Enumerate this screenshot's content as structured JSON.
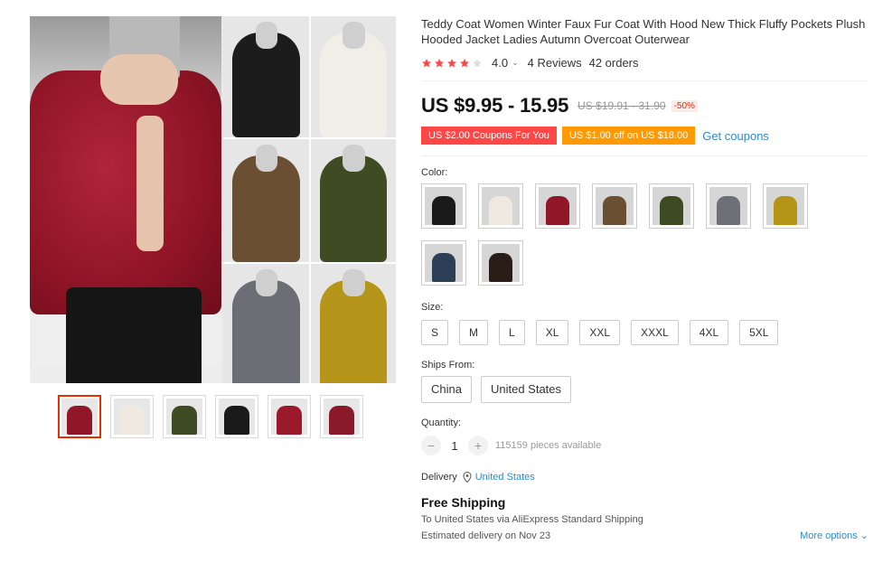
{
  "product": {
    "title": "Teddy Coat Women Winter Faux Fur Coat With Hood New Thick Fluffy Pockets Plush Hooded Jacket Ladies Autumn Overcoat Outerwear",
    "rating": 4.0,
    "rating_text": "4.0",
    "reviews": "4 Reviews",
    "orders": "42 orders"
  },
  "price": {
    "current": "US $9.95 - 15.95",
    "original": "US $19.91 - 31.90",
    "discount": "-50%"
  },
  "coupons": {
    "coupon1": "US $2.00 Coupons For You",
    "coupon2": "US $1.00 off on US $18.00",
    "get_label": "Get coupons"
  },
  "color": {
    "label": "Color:",
    "swatches": [
      "#1a1a1a",
      "#efe9e2",
      "#8f1728",
      "#6b4f33",
      "#3d4a22",
      "#6f6f77",
      "#b59516",
      "#2c3f57",
      "#2a1d18"
    ]
  },
  "size": {
    "label": "Size:",
    "options": [
      "S",
      "M",
      "L",
      "XL",
      "XXL",
      "XXXL",
      "4XL",
      "5XL"
    ]
  },
  "ships_from": {
    "label": "Ships From:",
    "options": [
      "China",
      "United States"
    ]
  },
  "quantity": {
    "label": "Quantity:",
    "value": "1",
    "available": "115159 pieces available"
  },
  "delivery": {
    "label": "Delivery",
    "location": "United States",
    "free_shipping": "Free Shipping",
    "to_prefix": "To United States via AliExpress Standard Shipping",
    "estimate": "Estimated delivery on Nov 23",
    "more_options": "More options"
  },
  "gallery": {
    "grid_colors": [
      "#1c1c1c",
      "#f1ede7",
      "#6b4f33",
      "#3f4c23",
      "#6c6d75",
      "#b5961a"
    ],
    "thumb_colors": [
      "#8f1728",
      "#efe9e2",
      "#3f4c23",
      "#1a1a1a",
      "#9a1a2c",
      "#8a1a2a"
    ]
  }
}
